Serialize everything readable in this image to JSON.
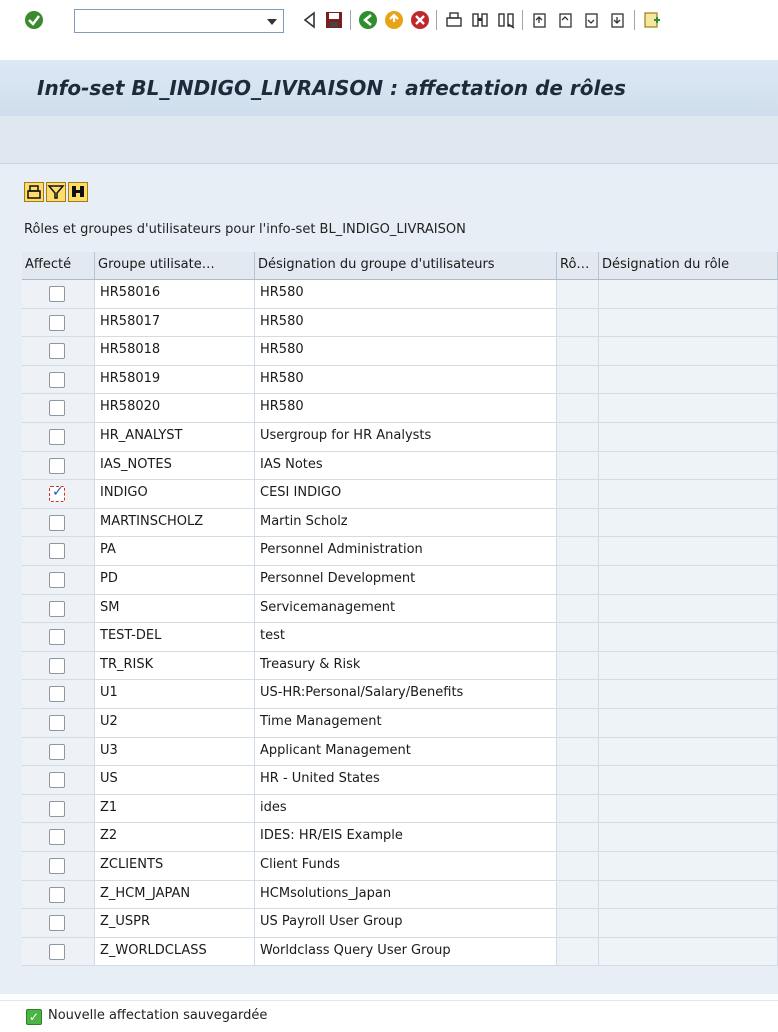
{
  "toolbar": {
    "command_field_value": "",
    "icons": [
      "enter-icon",
      "command-field",
      "back-icon",
      "save-icon",
      "green-back-icon",
      "exit-icon",
      "cancel-icon",
      "print-icon",
      "find-icon",
      "find-next-icon",
      "first-page-icon",
      "previous-page-icon",
      "next-page-icon",
      "last-page-icon",
      "create-session-icon"
    ]
  },
  "title": "Info-set BL_INDIGO_LIVRAISON : affectation de rôles",
  "table": {
    "caption": "Rôles et groupes d'utilisateurs pour l'info-set BL_INDIGO_LIVRAISON",
    "columns": [
      "Affecté",
      "Groupe utilisate…",
      "Désignation du groupe d'utilisateurs",
      "Rô…",
      "Désignation du rôle"
    ],
    "rows": [
      {
        "checked": false,
        "group": "HR58016",
        "description": "HR580"
      },
      {
        "checked": false,
        "group": "HR58017",
        "description": "HR580"
      },
      {
        "checked": false,
        "group": "HR58018",
        "description": "HR580"
      },
      {
        "checked": false,
        "group": "HR58019",
        "description": "HR580"
      },
      {
        "checked": false,
        "group": "HR58020",
        "description": "HR580"
      },
      {
        "checked": false,
        "group": "HR_ANALYST",
        "description": "Usergroup for HR Analysts"
      },
      {
        "checked": false,
        "group": "IAS_NOTES",
        "description": "IAS Notes"
      },
      {
        "checked": true,
        "group": "INDIGO",
        "description": "CESI INDIGO"
      },
      {
        "checked": false,
        "group": "MARTINSCHOLZ",
        "description": "Martin Scholz"
      },
      {
        "checked": false,
        "group": "PA",
        "description": "Personnel Administration"
      },
      {
        "checked": false,
        "group": "PD",
        "description": "Personnel Development"
      },
      {
        "checked": false,
        "group": "SM",
        "description": "Servicemanagement"
      },
      {
        "checked": false,
        "group": "TEST-DEL",
        "description": "test"
      },
      {
        "checked": false,
        "group": "TR_RISK",
        "description": "Treasury & Risk"
      },
      {
        "checked": false,
        "group": "U1",
        "description": "US-HR:Personal/Salary/Benefits"
      },
      {
        "checked": false,
        "group": "U2",
        "description": "Time Management"
      },
      {
        "checked": false,
        "group": "U3",
        "description": "Applicant Management"
      },
      {
        "checked": false,
        "group": "US",
        "description": "HR - United States"
      },
      {
        "checked": false,
        "group": "Z1",
        "description": "ides"
      },
      {
        "checked": false,
        "group": "Z2",
        "description": "IDES: HR/EIS Example"
      },
      {
        "checked": false,
        "group": "ZCLIENTS",
        "description": "Client Funds"
      },
      {
        "checked": false,
        "group": "Z_HCM_JAPAN",
        "description": "HCMsolutions_Japan"
      },
      {
        "checked": false,
        "group": "Z_USPR",
        "description": "US Payroll User Group"
      },
      {
        "checked": false,
        "group": "Z_WORLDCLASS",
        "description": "Worldclass Query User Group"
      }
    ]
  },
  "alv_toolbar": [
    "print-icon",
    "filter-icon",
    "find-icon"
  ],
  "status": {
    "message": "Nouvelle affectation sauvegardée",
    "type": "success"
  },
  "colors": {
    "title_band": "#dce8f4",
    "content_bg": "#e8eef5",
    "header_bg": "#e3e9f0",
    "success": "#4ab543"
  }
}
